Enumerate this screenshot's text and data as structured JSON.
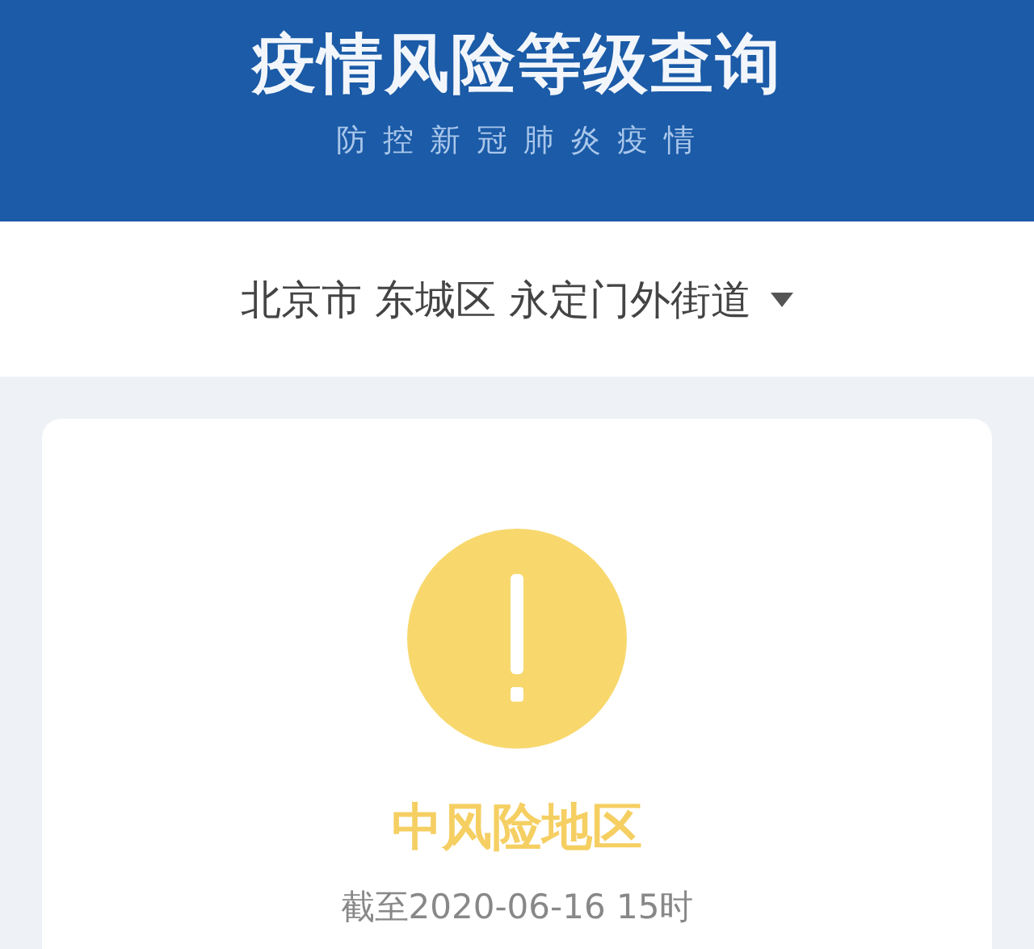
{
  "header": {
    "title": "疫情风险等级查询",
    "subtitle": "防 控 新 冠 肺 炎 疫 情"
  },
  "location_selector": {
    "value": "北京市 东城区 永定门外街道"
  },
  "result": {
    "kind": "medium",
    "label": "中风险地区",
    "updated": "截至2020-06-16 15时"
  }
}
